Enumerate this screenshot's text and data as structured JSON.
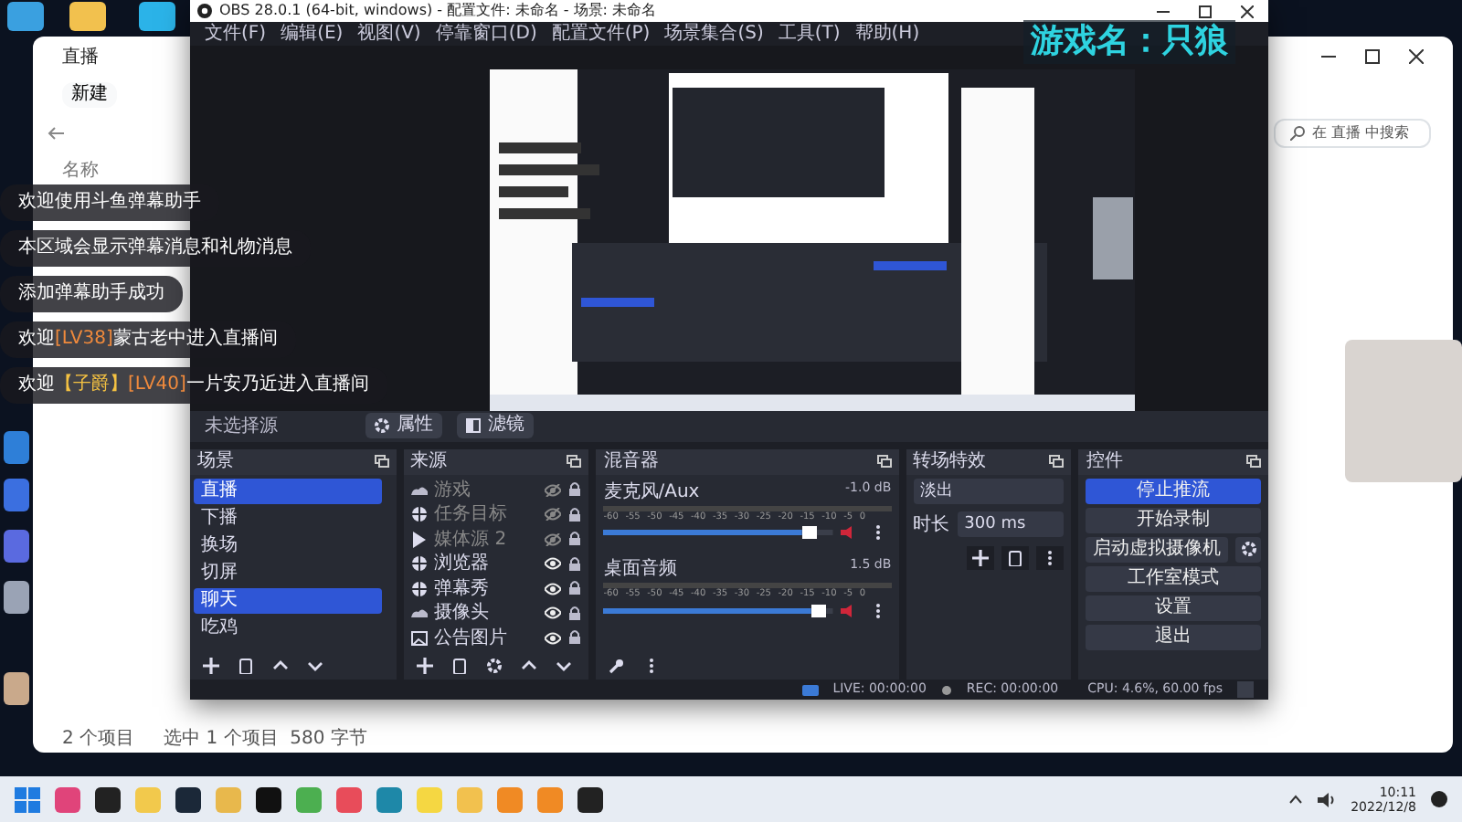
{
  "explorer": {
    "title": "直播",
    "new_button": "新建",
    "column": "名称",
    "search_placeholder": "在 直播 中搜索",
    "status": [
      "2 个项目",
      "选中 1 个项目  580 字节"
    ]
  },
  "obs": {
    "title": "OBS 28.0.1 (64-bit, windows) - 配置文件: 未命名 - 场景: 未命名",
    "menu": [
      "文件(F)",
      "编辑(E)",
      "视图(V)",
      "停靠窗口(D)",
      "配置文件(P)",
      "场景集合(S)",
      "工具(T)",
      "帮助(H)"
    ],
    "source_bar": {
      "label": "未选择源",
      "properties": "属性",
      "filters": "滤镜"
    },
    "scenes": {
      "title": "场景",
      "items": [
        {
          "name": "直播",
          "selected": true
        },
        {
          "name": "下播",
          "selected": false
        },
        {
          "name": "换场",
          "selected": false
        },
        {
          "name": "切屏",
          "selected": false
        },
        {
          "name": "聊天",
          "selected": true
        },
        {
          "name": "吃鸡",
          "selected": false
        }
      ]
    },
    "sources": {
      "title": "来源",
      "items": [
        {
          "name": "游戏",
          "kind": "game",
          "visible": false
        },
        {
          "name": "任务目标",
          "kind": "browser",
          "visible": false
        },
        {
          "name": "媒体源 2",
          "kind": "media",
          "visible": false
        },
        {
          "name": "浏览器",
          "kind": "browser",
          "visible": true
        },
        {
          "name": "弹幕秀",
          "kind": "browser",
          "visible": true
        },
        {
          "name": "摄像头",
          "kind": "game",
          "visible": true
        },
        {
          "name": "公告图片",
          "kind": "image",
          "visible": true
        }
      ]
    },
    "mixer": {
      "title": "混音器",
      "channels": [
        {
          "name": "麦克风/Aux",
          "reading": "-1.0 dB",
          "level": 0.93,
          "ticks": [
            "-60",
            "-55",
            "-50",
            "-45",
            "-40",
            "-35",
            "-30",
            "-25",
            "-20",
            "-15",
            "-10",
            "-5",
            "0"
          ]
        },
        {
          "name": "桌面音频",
          "reading": "1.5 dB",
          "level": 0.97,
          "ticks": [
            "-60",
            "-55",
            "-50",
            "-45",
            "-40",
            "-35",
            "-30",
            "-25",
            "-20",
            "-15",
            "-10",
            "-5",
            "0"
          ]
        }
      ]
    },
    "transitions": {
      "title": "转场特效",
      "type": "淡出",
      "duration_label": "时长",
      "duration": "300 ms"
    },
    "controls": {
      "title": "控件",
      "buttons": [
        {
          "label": "停止推流",
          "kind": "primary"
        },
        {
          "label": "开始录制",
          "kind": "plain"
        },
        {
          "label": "启动虚拟摄像机",
          "kind": "gear"
        },
        {
          "label": "工作室模式",
          "kind": "plain"
        },
        {
          "label": "设置",
          "kind": "plain"
        },
        {
          "label": "退出",
          "kind": "plain"
        }
      ]
    },
    "status": {
      "live": "LIVE: 00:00:00",
      "rec": "REC: 00:00:00",
      "cpu": "CPU: 4.6%, 60.00 fps"
    }
  },
  "overlay": {
    "game_title": "游戏名：只狼",
    "messages": [
      {
        "segments": [
          {
            "text": "欢迎使用斗鱼弹幕助手",
            "color": "#ffffff"
          }
        ]
      },
      {
        "segments": [
          {
            "text": "本区域会显示弹幕消息和礼物消息",
            "color": "#ffffff"
          }
        ]
      },
      {
        "segments": [
          {
            "text": "添加弹幕助手成功",
            "color": "#ffffff"
          }
        ]
      },
      {
        "segments": [
          {
            "text": "欢迎",
            "color": "#ffffff"
          },
          {
            "text": "[LV38]",
            "color": "#f08a3c"
          },
          {
            "text": "蒙古老中进入直播间",
            "color": "#ffffff"
          }
        ]
      },
      {
        "segments": [
          {
            "text": "欢迎",
            "color": "#ffffff"
          },
          {
            "text": "【子爵】",
            "color": "#f5c242"
          },
          {
            "text": "[LV40]",
            "color": "#f08a3c"
          },
          {
            "text": "一片安乃近进入直播间",
            "color": "#ffffff"
          }
        ]
      }
    ]
  },
  "taskbar": {
    "time": "10:11",
    "date": "2022/12/8"
  }
}
